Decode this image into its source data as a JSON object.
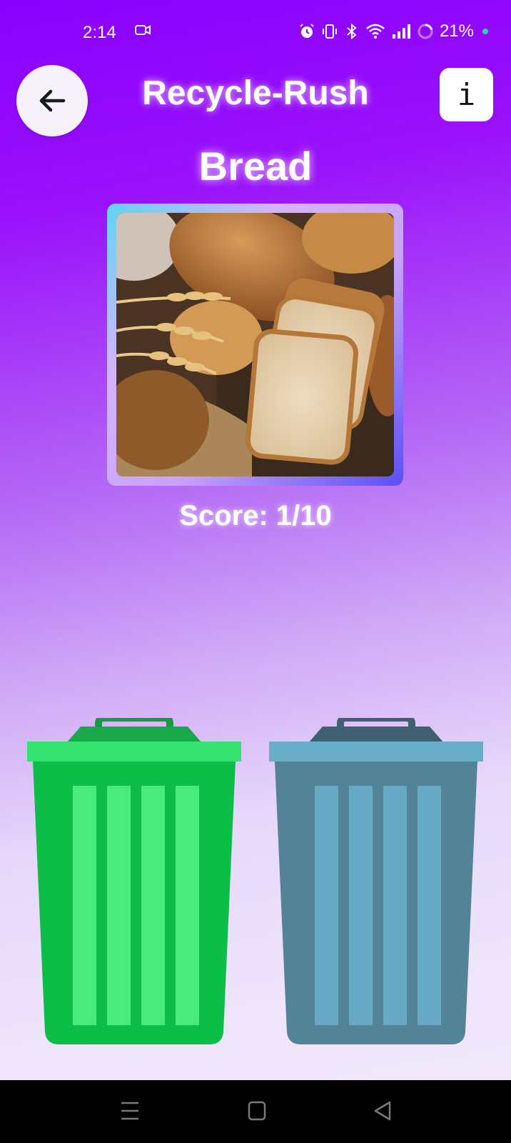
{
  "status_bar": {
    "time": "2:14",
    "battery": "21%",
    "icons": [
      "video-camera-icon",
      "alarm-icon",
      "vibrate-icon",
      "bluetooth-icon",
      "wifi-icon",
      "signal-icon",
      "battery-ring-icon"
    ]
  },
  "header": {
    "back_icon": "arrow-left-icon",
    "title": "Recycle-Rush",
    "info_label": "i"
  },
  "game": {
    "item_name": "Bread",
    "score_text": "Score: 1/10"
  },
  "bins": [
    {
      "name": "green-bin",
      "color": "#1dc850"
    },
    {
      "name": "blue-bin",
      "color": "#5c8ea3"
    }
  ],
  "nav_bar": {
    "icons": [
      "menu-icon",
      "home-icon",
      "back-icon"
    ]
  },
  "colors": {
    "accent": "#8a00ff",
    "green_bin": "#1dc850",
    "blue_bin": "#5c8ea3"
  }
}
